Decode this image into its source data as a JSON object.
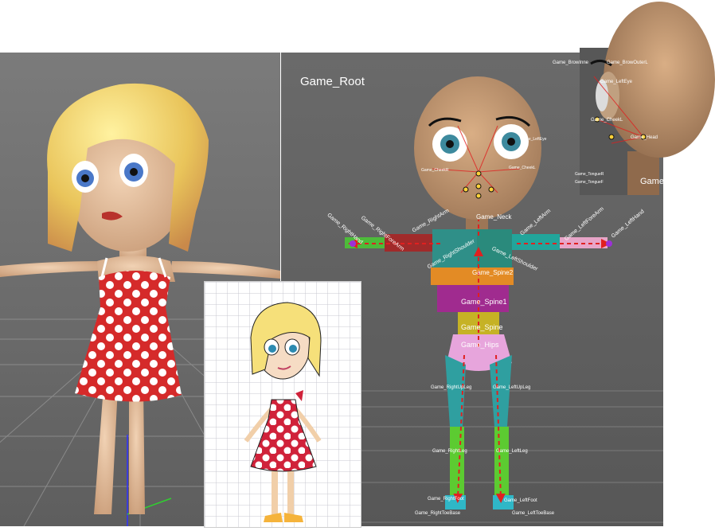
{
  "rig_panel": {
    "root_label": "Game_Root",
    "bones": {
      "neck": "Game_Neck",
      "spine2": "Game_Spine2",
      "spine1": "Game_Spine1",
      "spine": "Game_Spine",
      "hips": "Game_Hips",
      "right_arm": "Game_RightArm",
      "right_forearm": "Game_RightForeArm",
      "right_hand": "Game_RightHand",
      "right_shoulder": "Game_RightShoulder",
      "left_arm": "Game_LeftArm",
      "left_forearm": "Game_LeftForeArm",
      "left_hand": "Game_LeftHand",
      "left_shoulder": "Game_LeftShoulder",
      "right_upleg": "Game_RightUpLeg",
      "left_upleg": "Game_LeftUpLeg",
      "right_leg": "Game_RightLeg",
      "left_leg": "Game_LeftLeg",
      "right_foot": "Game_RightFoot",
      "left_foot": "Game_LeftFoot",
      "right_toebase": "Game_RightToeBase",
      "left_toebase": "Game_LeftToeBase",
      "cheek_r": "Game_CheekR",
      "cheek_l": "Game_CheekL",
      "left_eye": "Game_LeftEye"
    }
  },
  "head_panel": {
    "brow_inner": "Game_BrowInne",
    "brow_outer_l": "Game_BrowOuterL",
    "left_eye": "Game_LeftEye",
    "cheek_l": "Game_CheekL",
    "head": "Game_Head",
    "tongue_r": "Game_TongueR",
    "tongue_f": "Game_TongueF",
    "neck_cut": "Game_N"
  }
}
